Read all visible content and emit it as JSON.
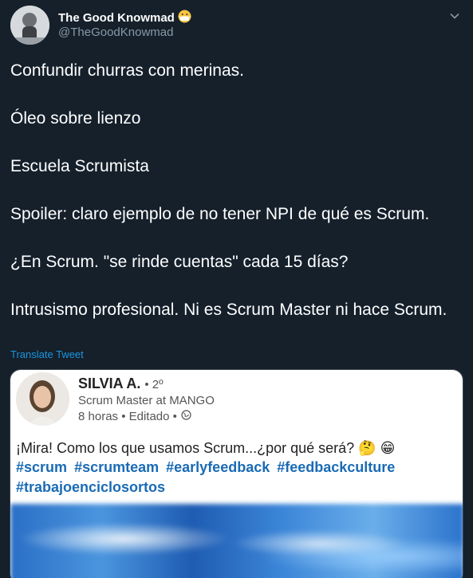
{
  "author": {
    "display_name": "The Good Knowmad",
    "handle": "@TheGoodKnowmad",
    "emoji_icon": "face-with-medical-mask-icon"
  },
  "tweet": {
    "paragraphs": [
      "Confundir churras con merinas.",
      "Óleo sobre lienzo",
      "Escuela Scrumista",
      "Spoiler: claro ejemplo de no tener NPI de qué es Scrum.",
      "¿En Scrum. \"se rinde cuentas\" cada 15 días?",
      "Intrusismo profesional. Ni es Scrum Master ni hace Scrum."
    ],
    "translate_label": "Translate Tweet"
  },
  "embedded_post": {
    "name": "SILVIA A.",
    "degree": "• 2º",
    "title": "Scrum Master at MANGO",
    "meta": "8 horas • Editado •",
    "text": "¡Mira! Como los que usamos Scrum...¿por qué  será? 🤔 😁",
    "hashtags": [
      "#scrum",
      "#scrumteam",
      "#earlyfeedback",
      "#feedbackculture",
      "#trabajoenciclosortos"
    ]
  },
  "colors": {
    "background": "#15202b",
    "secondary_text": "#8899a6",
    "link": "#1b95e0",
    "hashtag": "#1a6bb5"
  }
}
